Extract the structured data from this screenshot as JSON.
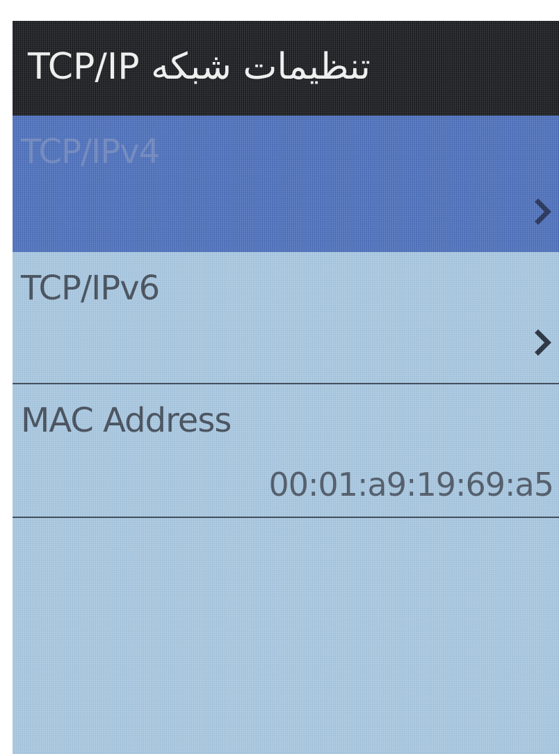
{
  "header": {
    "title": "تنظیمات شبکه TCP/IP"
  },
  "menu": {
    "items": [
      {
        "label": "TCP/IPv4",
        "selected": true,
        "chevron_icon": "chevron-right-icon"
      },
      {
        "label": "TCP/IPv6",
        "selected": false,
        "chevron_icon": "chevron-right-icon"
      }
    ]
  },
  "mac": {
    "label": "MAC Address",
    "value": "00:01:a9:19:69:a5"
  },
  "colors": {
    "title_bar": "#15171b",
    "selected_row": "#4a6ebc",
    "screen_background": "#a7c8e2",
    "divider": "#33404f"
  }
}
